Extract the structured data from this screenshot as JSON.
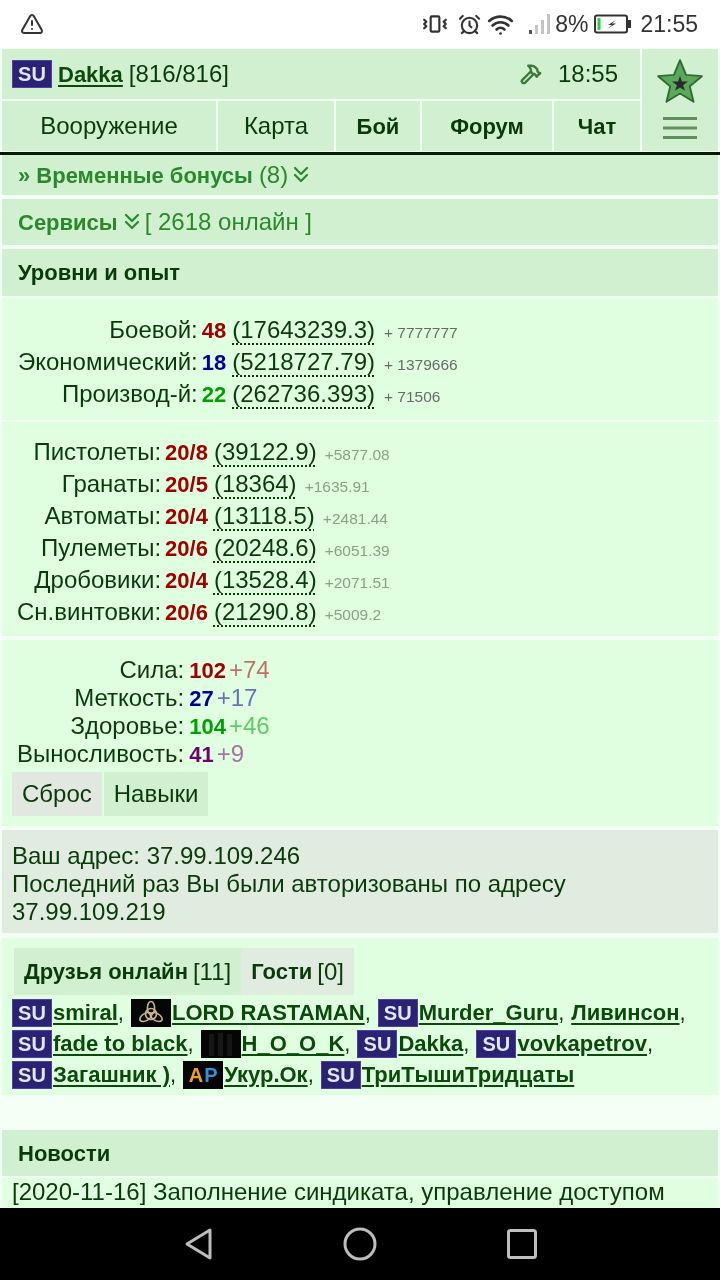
{
  "status_bar": {
    "battery": "8%",
    "time": "21:55"
  },
  "header": {
    "player": {
      "badge": {
        "kind": "su",
        "letters": [
          {
            "text": "SU",
            "color": "#e6e6ff"
          }
        ]
      },
      "name": "Dakka",
      "hp": "[816/816]"
    },
    "time": "18:55",
    "tabs": [
      {
        "label": "Вооружение",
        "highlighted": false
      },
      {
        "label": "Карта",
        "highlighted": false
      },
      {
        "label": "Бой",
        "highlighted": true
      },
      {
        "label": "Форум",
        "highlighted": true
      },
      {
        "label": "Чат",
        "highlighted": true
      }
    ]
  },
  "bonuses": {
    "title": "» Временные бонусы",
    "count": "(8)",
    "expanded": false
  },
  "services": {
    "title": "Сервисы",
    "online": "[ 2618 онлайн ]",
    "expanded": false
  },
  "levels": {
    "title": "Уровни и опыт",
    "rows": [
      {
        "label": "Боевой:",
        "value": "48",
        "color": "#a00000",
        "experience": "(17643239.3)",
        "bonus": "+ 7777777"
      },
      {
        "label": "Экономический:",
        "value": "18",
        "color": "#0000a0",
        "experience": "(5218727.79)",
        "bonus": "+ 1379666"
      },
      {
        "label": "Производ-й:",
        "value": "22",
        "color": "#00a000",
        "experience": "(262736.393)",
        "bonus": "+ 71506"
      }
    ]
  },
  "weapons": [
    {
      "label": "Пистолеты:",
      "value": "20/8",
      "experience": "(39122.9)",
      "bonus": "+5877.08"
    },
    {
      "label": "Гранаты:",
      "value": "20/5",
      "experience": "(18364)",
      "bonus": "+1635.91"
    },
    {
      "label": "Автоматы:",
      "value": "20/4",
      "experience": "(13118.5)",
      "bonus": "+2481.44"
    },
    {
      "label": "Пулеметы:",
      "value": "20/6",
      "experience": "(20248.6)",
      "bonus": "+6051.39"
    },
    {
      "label": "Дробовики:",
      "value": "20/4",
      "experience": "(13528.4)",
      "bonus": "+2071.51"
    },
    {
      "label": "Сн.винтовки:",
      "value": "20/6",
      "experience": "(21290.8)",
      "bonus": "+5009.2"
    }
  ],
  "stats": {
    "rows": [
      {
        "label": "Сила:",
        "value": "102",
        "bonus": "+74",
        "color": "#a00000"
      },
      {
        "label": "Меткость:",
        "value": "27",
        "bonus": "+17",
        "color": "#0000a0"
      },
      {
        "label": "Здоровье:",
        "value": "104",
        "bonus": "+46",
        "color": "#00a000"
      },
      {
        "label": "Выносливость:",
        "value": "41",
        "bonus": "+9",
        "color": "#700070"
      }
    ],
    "buttons": [
      {
        "label": "Сброс",
        "highlighted": false
      },
      {
        "label": "Навыки",
        "highlighted": true
      }
    ]
  },
  "address": {
    "lines": [
      "Ваш адрес: 37.99.109.246",
      "Последний раз Вы были авторизованы по адресу 37.99.109.219"
    ]
  },
  "friends": {
    "tabs": [
      {
        "label": "Друзья онлайн",
        "count": "[11]",
        "selected": true
      },
      {
        "label": "Гости",
        "count": "[0]",
        "selected": false
      }
    ],
    "list": [
      {
        "name": "smiral",
        "trailing": ",",
        "badge": {
          "kind": "su",
          "letters": [
            {
              "text": "SU",
              "color": "#e6e6ff"
            }
          ]
        }
      },
      {
        "name": "LORD RASTAMAN",
        "trailing": ",",
        "badge": {
          "kind": "knot"
        }
      },
      {
        "name": "Murder_Guru",
        "trailing": ",",
        "badge": {
          "kind": "su",
          "letters": [
            {
              "text": "SU",
              "color": "#e6e6ff"
            }
          ]
        }
      },
      {
        "name": "Ливинсон",
        "trailing": ","
      },
      {
        "name": "fade to black",
        "trailing": ",",
        "badge": {
          "kind": "su",
          "letters": [
            {
              "text": "SU",
              "color": "#e6e6ff"
            }
          ]
        }
      },
      {
        "name": "H_O_O_K",
        "trailing": ",",
        "badge": {
          "kind": "dark"
        }
      },
      {
        "name": "Dakka",
        "trailing": ",",
        "badge": {
          "kind": "su",
          "letters": [
            {
              "text": "SU",
              "color": "#e6e6ff"
            }
          ]
        }
      },
      {
        "name": "vovkapetrov",
        "trailing": ",",
        "badge": {
          "kind": "su",
          "letters": [
            {
              "text": "SU",
              "color": "#e6e6ff"
            }
          ]
        }
      },
      {
        "name": "Загашник )",
        "trailing": ",",
        "badge": {
          "kind": "su",
          "letters": [
            {
              "text": "SU",
              "color": "#e6e6ff"
            }
          ]
        }
      },
      {
        "name": "Укур.Ок",
        "trailing": ",",
        "badge": {
          "kind": "ap",
          "letters": [
            {
              "text": "A",
              "color": "#f0a020"
            },
            {
              "text": "P",
              "color": "#3090e0"
            }
          ]
        }
      },
      {
        "name": "ТриТышиТридцаты",
        "badge": {
          "kind": "su",
          "letters": [
            {
              "text": "SU",
              "color": "#e6e6ff"
            }
          ]
        }
      }
    ]
  },
  "news": {
    "title": "Новости",
    "items": [
      "[2020-11-16] Заполнение синдиката, управление доступом"
    ]
  }
}
